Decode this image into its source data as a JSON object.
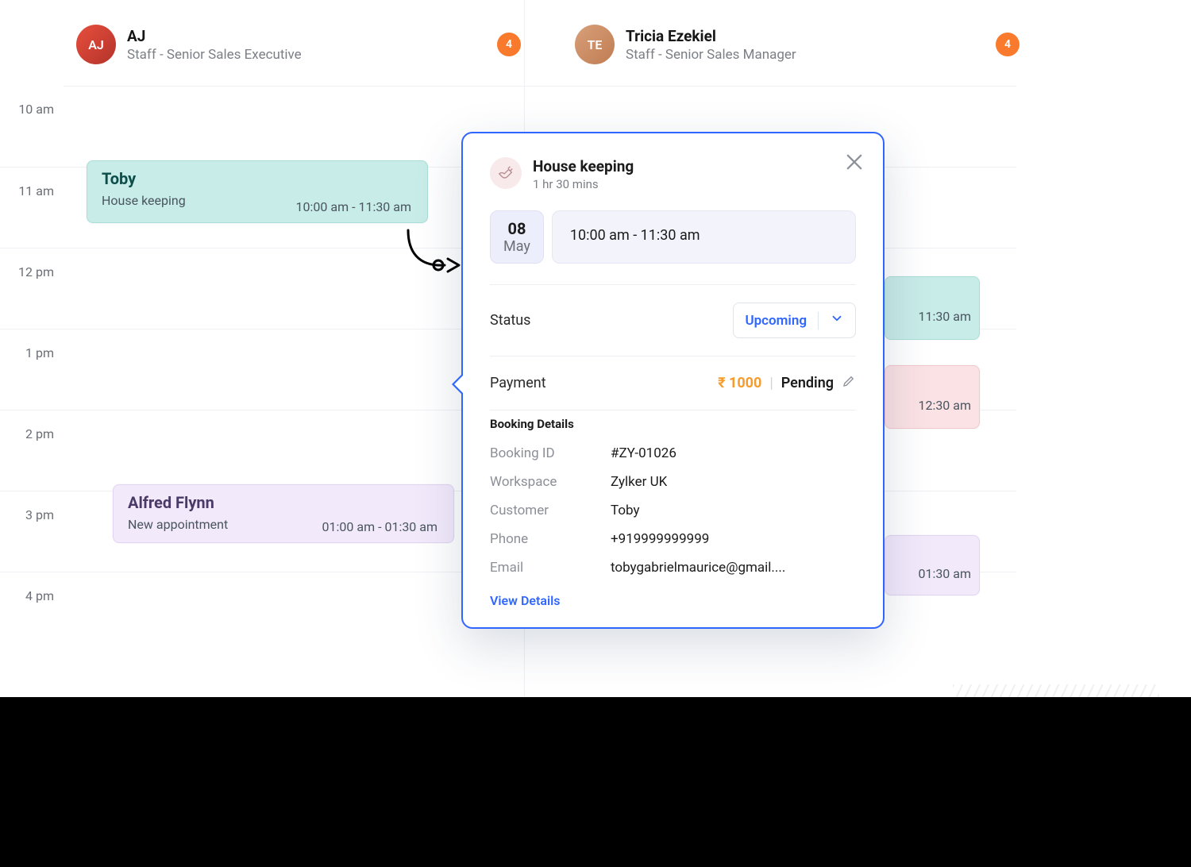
{
  "staff": [
    {
      "name": "AJ",
      "role": "Staff - Senior Sales Executive",
      "badge": "4",
      "initials": "AJ"
    },
    {
      "name": "Tricia Ezekiel",
      "role": "Staff - Senior Sales Manager",
      "badge": "4",
      "initials": "TE"
    }
  ],
  "times": [
    "10 am",
    "11 am",
    "12 pm",
    "1 pm",
    "2 pm",
    "3 pm",
    "4 pm"
  ],
  "events": {
    "toby": {
      "title": "Toby",
      "subtitle": "House keeping",
      "time": "10:00 am - 11:30 am"
    },
    "alfred": {
      "title": "Alfred Flynn",
      "subtitle": "New appointment",
      "time": "01:00 am - 01:30 am"
    },
    "teal_time": "11:30 am",
    "pink_time": "12:30 am",
    "purple_time": "01:30 am"
  },
  "popover": {
    "title": "House keeping",
    "duration": "1 hr 30 mins",
    "date_day": "08",
    "date_month": "May",
    "time_range": "10:00 am - 11:30 am",
    "status_label": "Status",
    "status_value": "Upcoming",
    "payment_label": "Payment",
    "payment_amount": "₹ 1000",
    "payment_status": "Pending",
    "details_heading": "Booking Details",
    "booking_id_label": "Booking ID",
    "booking_id": "#ZY-01026",
    "workspace_label": "Workspace",
    "workspace": "Zylker UK",
    "customer_label": "Customer",
    "customer": "Toby",
    "phone_label": "Phone",
    "phone": "+919999999999",
    "email_label": "Email",
    "email": "tobygabrielmaurice@gmail....",
    "view_details": "View Details"
  }
}
